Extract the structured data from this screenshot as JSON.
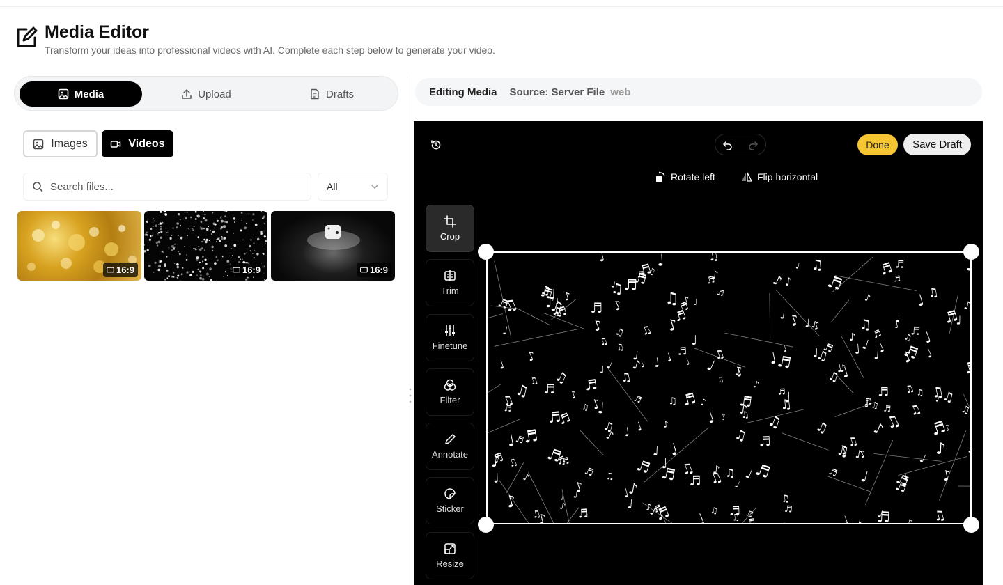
{
  "header": {
    "title": "Media Editor",
    "subtitle": "Transform your ideas into professional videos with AI. Complete each step below to generate your video."
  },
  "tabs": [
    {
      "label": "Media",
      "icon": "image-icon",
      "active": true
    },
    {
      "label": "Upload",
      "icon": "upload-icon",
      "active": false
    },
    {
      "label": "Drafts",
      "icon": "document-icon",
      "active": false
    }
  ],
  "filters": {
    "images_label": "Images",
    "videos_label": "Videos",
    "active": "Videos"
  },
  "search": {
    "placeholder": "Search files...",
    "select_value": "All"
  },
  "thumbnails": [
    {
      "ratio": "16:9",
      "theme": "gold-bubbles"
    },
    {
      "ratio": "16:9",
      "theme": "white-particles"
    },
    {
      "ratio": "16:9",
      "theme": "spotlight-dice"
    }
  ],
  "infobar": {
    "label": "Editing Media",
    "source": "Source: Server File",
    "origin": "web"
  },
  "editor": {
    "done_label": "Done",
    "save_label": "Save Draft",
    "rotate_label": "Rotate left",
    "flip_label": "Flip horizontal",
    "tools": [
      {
        "label": "Crop",
        "icon": "crop-icon",
        "active": true
      },
      {
        "label": "Trim",
        "icon": "trim-icon",
        "active": false
      },
      {
        "label": "Finetune",
        "icon": "sliders-icon",
        "active": false
      },
      {
        "label": "Filter",
        "icon": "filter-icon",
        "active": false
      },
      {
        "label": "Annotate",
        "icon": "pencil-icon",
        "active": false
      },
      {
        "label": "Sticker",
        "icon": "sticker-icon",
        "active": false
      },
      {
        "label": "Resize",
        "icon": "resize-icon",
        "active": false
      }
    ]
  },
  "colors": {
    "accent_yellow": "#f5c631",
    "active_black": "#000000",
    "editor_bg": "#000000"
  }
}
